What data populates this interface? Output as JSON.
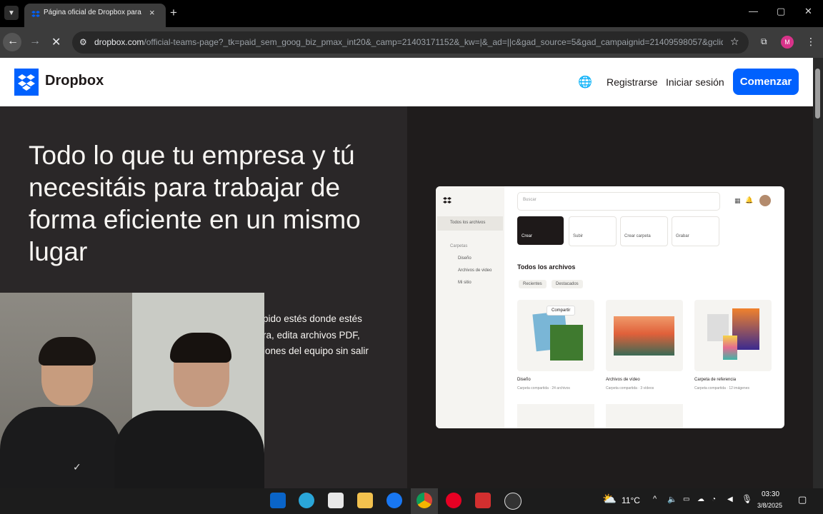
{
  "browser": {
    "tab_title": "Página oficial de Dropbox para",
    "tab_close": "×",
    "new_tab": "+",
    "url_host": "dropbox.com",
    "url_path": "/official-teams-page?_tk=paid_sem_goog_biz_pmax_int20&_camp=21403171152&_kw=|&_ad=||c&gad_source=5&gad_campaignid=21409598057&gclid...",
    "profile_initial": "M",
    "window_controls": [
      "—",
      "▢",
      "✕"
    ]
  },
  "header": {
    "logo_text": "Dropbox",
    "register": "Registrarse",
    "login": "Iniciar sesión",
    "cta": "Comenzar"
  },
  "hero": {
    "headline": "Todo lo que tu empresa y tú necesitáis para trabajar de forma eficiente en un mismo lugar",
    "sub_lines": [
      "pido estés donde estés",
      "ra, edita archivos PDF,",
      "iones del equipo sin salir"
    ]
  },
  "mockup": {
    "search": "Buscar",
    "side_all": "Todos los archivos",
    "side_section": "Carpetas",
    "side_items": [
      "Diseño",
      "Archivos de video",
      "Mi sitio"
    ],
    "actions": [
      "Crear",
      "Subir",
      "Crear carpeta",
      "Grabar"
    ],
    "section_title": "Todos los archivos",
    "filters": [
      "Recientes",
      "Destacados"
    ],
    "share_button": "Compartir",
    "cards": [
      {
        "name": "Diseño",
        "meta": "Carpeta compartida · 24 archivos"
      },
      {
        "name": "Archivos de vídeo",
        "meta": "Carpeta compartida · 3 vídeos"
      },
      {
        "name": "Carpeta de referencia",
        "meta": "Carpeta compartida · 12 imágenes"
      }
    ]
  },
  "taskbar": {
    "weather": "11°C",
    "time": "03:30",
    "date": "3/8/2025"
  }
}
